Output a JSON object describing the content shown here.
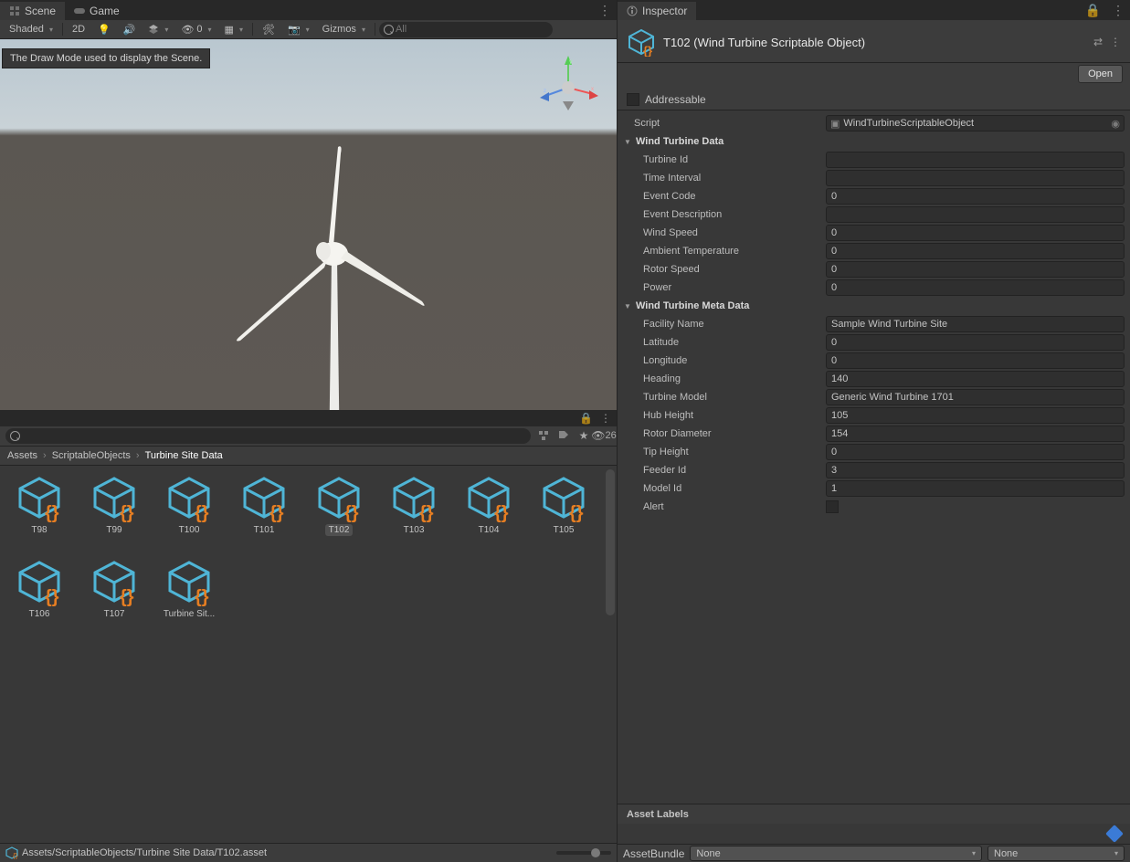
{
  "tabs": {
    "scene": "Scene",
    "game": "Game",
    "inspector": "Inspector"
  },
  "toolbar": {
    "shading": "Shaded",
    "twoD": "2D",
    "gizmos": "Gizmos",
    "search_ph": "All",
    "hidden": "0"
  },
  "tooltip": "The Draw Mode used to display the Scene.",
  "breadcrumb": {
    "a": "Assets",
    "b": "ScriptableObjects",
    "c": "Turbine Site Data"
  },
  "project": {
    "count": "26"
  },
  "assets": [
    "T98",
    "T99",
    "T100",
    "T101",
    "T102",
    "T103",
    "T104",
    "T105",
    "T106",
    "T107",
    "Turbine Sit..."
  ],
  "selected_asset": "T102",
  "footer_path": "Assets/ScriptableObjects/Turbine Site Data/T102.asset",
  "inspector": {
    "title": "T102 (Wind Turbine Scriptable Object)",
    "open": "Open",
    "addressable": "Addressable",
    "script_lbl": "Script",
    "script_val": "WindTurbineScriptableObject",
    "group1": "Wind Turbine Data",
    "fields1": [
      {
        "k": "Turbine Id",
        "v": ""
      },
      {
        "k": "Time Interval",
        "v": ""
      },
      {
        "k": "Event Code",
        "v": "0"
      },
      {
        "k": "Event Description",
        "v": ""
      },
      {
        "k": "Wind Speed",
        "v": "0"
      },
      {
        "k": "Ambient Temperature",
        "v": "0"
      },
      {
        "k": "Rotor Speed",
        "v": "0"
      },
      {
        "k": "Power",
        "v": "0"
      }
    ],
    "group2": "Wind Turbine Meta Data",
    "fields2": [
      {
        "k": "Facility Name",
        "v": "Sample Wind Turbine Site"
      },
      {
        "k": "Latitude",
        "v": "0"
      },
      {
        "k": "Longitude",
        "v": "0"
      },
      {
        "k": "Heading",
        "v": "140"
      },
      {
        "k": "Turbine Model",
        "v": "Generic Wind Turbine 1701"
      },
      {
        "k": "Hub Height",
        "v": "105"
      },
      {
        "k": "Rotor Diameter",
        "v": "154"
      },
      {
        "k": "Tip Height",
        "v": "0"
      },
      {
        "k": "Feeder Id",
        "v": "3"
      },
      {
        "k": "Model Id",
        "v": "1"
      }
    ],
    "alert": "Alert",
    "asset_labels": "Asset Labels",
    "bundle_lbl": "AssetBundle",
    "bundle_v1": "None",
    "bundle_v2": "None"
  }
}
